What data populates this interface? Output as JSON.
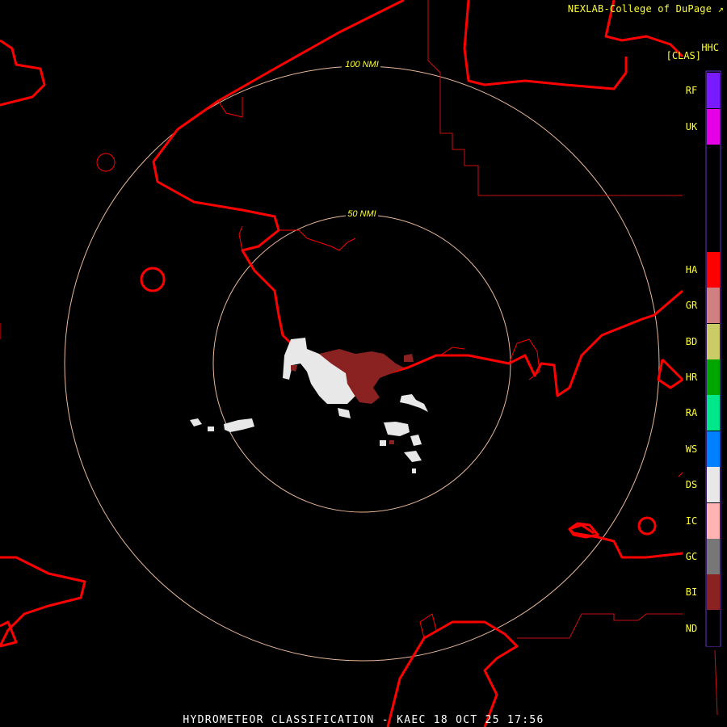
{
  "header": {
    "credit": "NEXLAB-College of DuPage",
    "credit_icon": "diagonal-arrow-icon",
    "product_code": "HHC",
    "product_unit": "[CLAS]"
  },
  "footer": {
    "product_name": "HYDROMETEOR CLASSIFICATION",
    "separator": "-",
    "station": "KAEC",
    "datetime": "18 OCT 25 17:56"
  },
  "range_rings": [
    {
      "label": "100 NMI"
    },
    {
      "label": "50 NMI"
    }
  ],
  "legend": {
    "categories": [
      {
        "code": "RF",
        "color": "#7a1aff"
      },
      {
        "code": "UK",
        "color": "#e600e6"
      },
      {
        "code": "HA",
        "color": "#ff0000"
      },
      {
        "code": "GR",
        "color": "#d08080"
      },
      {
        "code": "BD",
        "color": "#cccc66"
      },
      {
        "code": "HR",
        "color": "#00a600"
      },
      {
        "code": "RA",
        "color": "#00e68a"
      },
      {
        "code": "WS",
        "color": "#0080ff"
      },
      {
        "code": "DS",
        "color": "#e8e8e8"
      },
      {
        "code": "IC",
        "color": "#ffb3b3"
      },
      {
        "code": "GC",
        "color": "#777777"
      },
      {
        "code": "BI",
        "color": "#8b2222"
      },
      {
        "code": "ND",
        "color": "#000000"
      }
    ],
    "border_color": "#6a2ed6"
  },
  "colors": {
    "coastline": "#ff0000",
    "boundary": "#cc1010",
    "ring": "#e8b89a",
    "ring_label": "#ffff33",
    "text_yellow": "#ffff33",
    "footer_text": "#ffffff"
  }
}
